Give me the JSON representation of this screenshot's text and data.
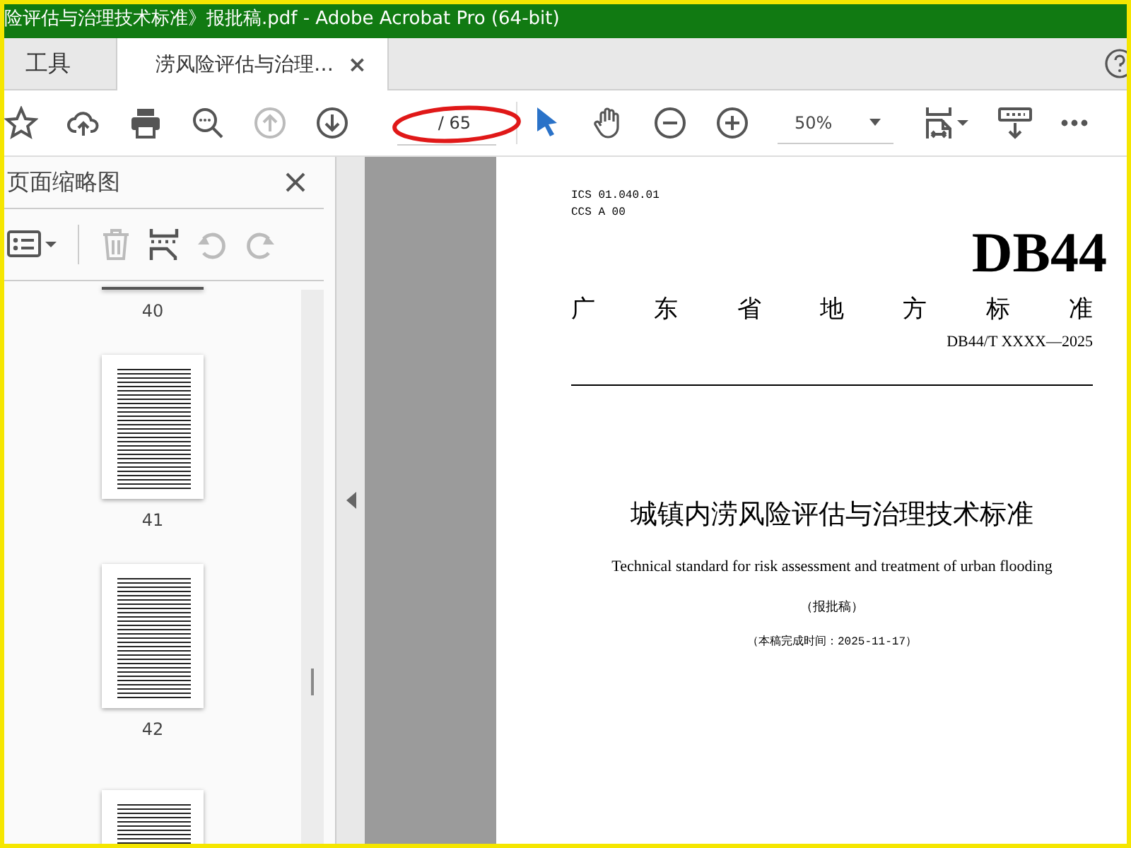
{
  "window": {
    "title": "险评估与治理技术标准》报批稿.pdf - Adobe Acrobat Pro (64-bit)"
  },
  "tabs": [
    {
      "label": "工具",
      "selected": false
    },
    {
      "label": "涝风险评估与治理…",
      "selected": true,
      "close": "×"
    }
  ],
  "toolbar": {
    "page_total": "/ 65",
    "zoom": "50%"
  },
  "sidebar": {
    "title": "页面缩略图",
    "thumbnails": [
      {
        "kind": "cut-top",
        "label": "40"
      },
      {
        "kind": "full",
        "label": "41"
      },
      {
        "kind": "full",
        "label": "42"
      },
      {
        "kind": "cut-bottom"
      }
    ]
  },
  "document": {
    "ics": "ICS 01.040.01",
    "ccs": "CCS A 00",
    "code": "DB44",
    "category": "广东省地方标准",
    "number": "DB44/T XXXX—2025",
    "title_cn": "城镇内涝风险评估与治理技术标准",
    "title_en": "Technical standard for risk assessment and treatment of urban flooding",
    "stage": "（报批稿）",
    "completed": "（本稿完成时间：2025-11-17）"
  }
}
